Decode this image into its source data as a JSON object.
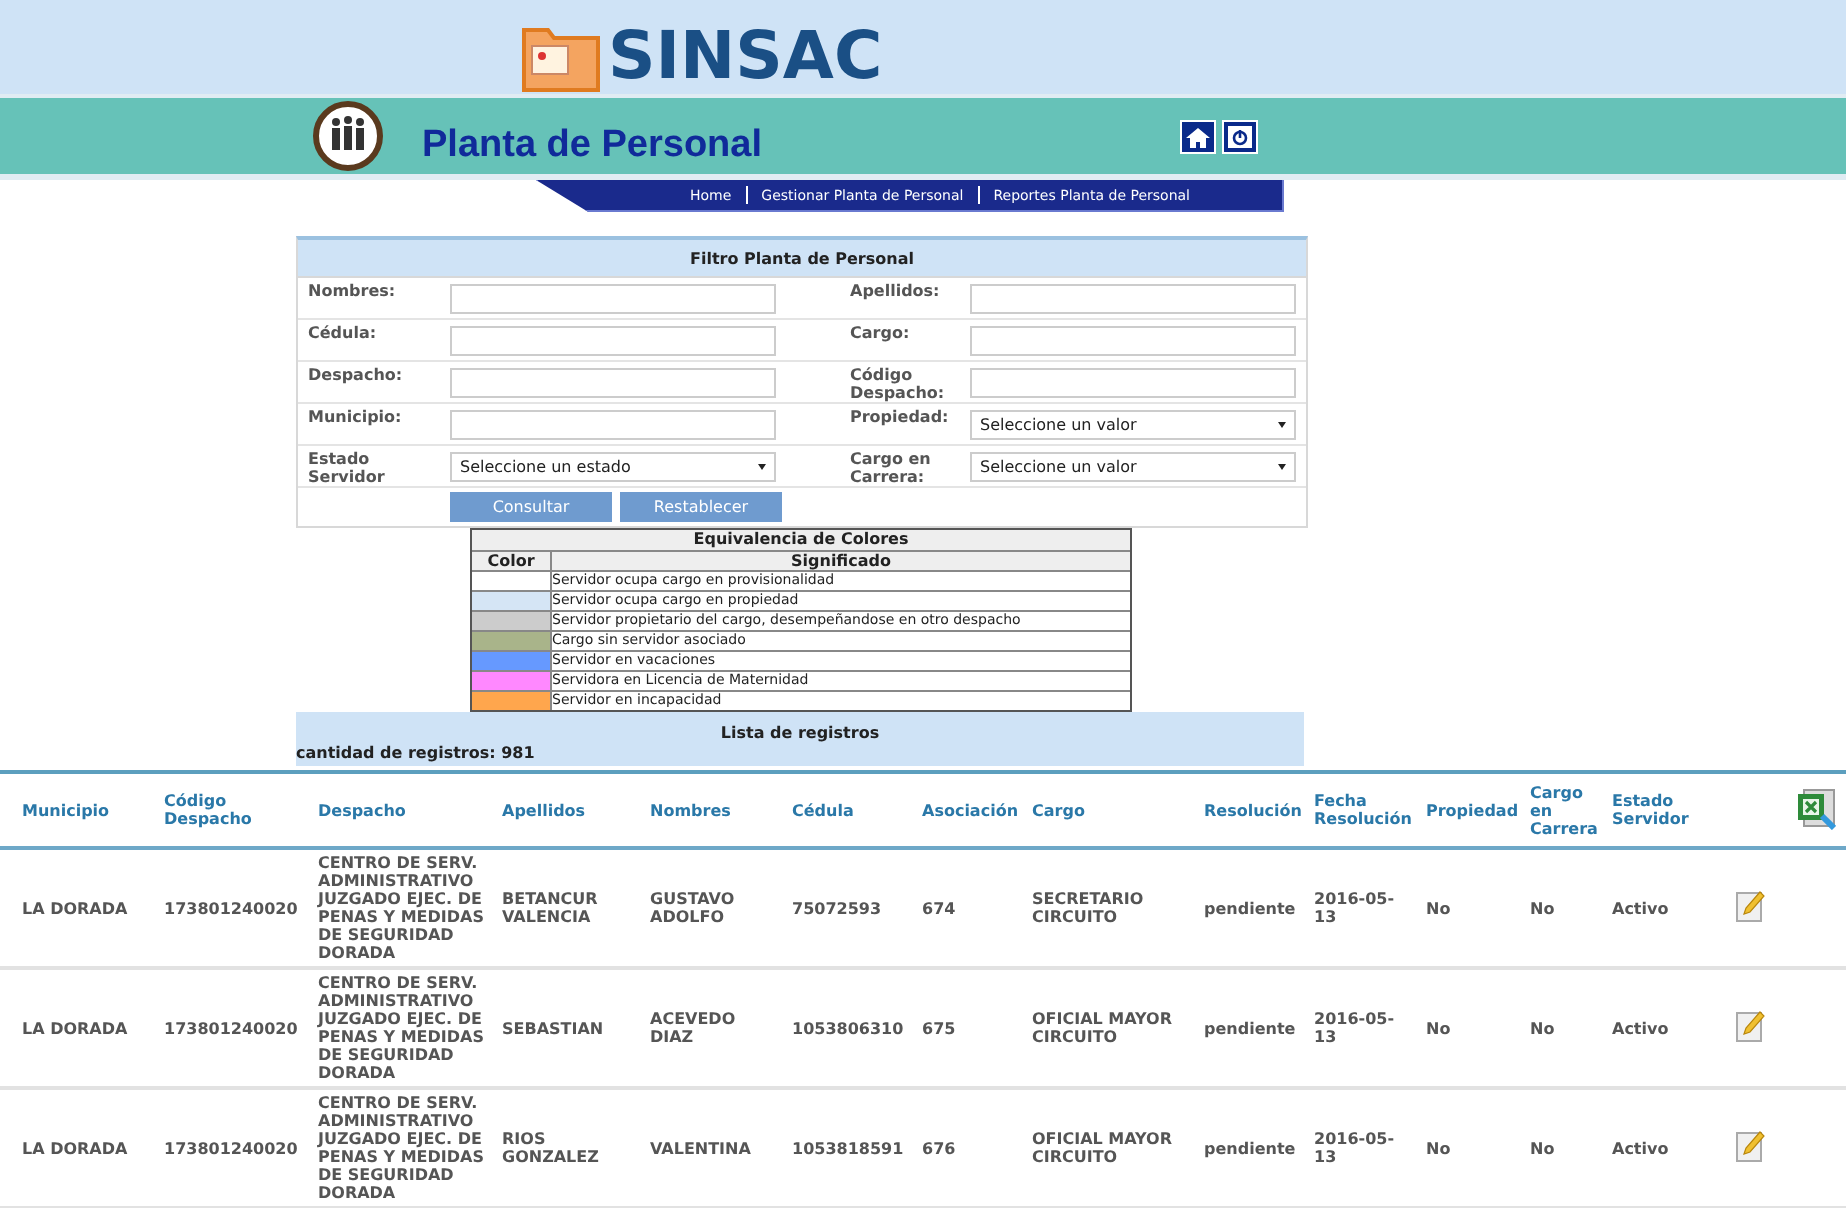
{
  "header": {
    "logo": "SINSAC"
  },
  "banner": {
    "title": "Planta de Personal"
  },
  "nav": [
    "Home",
    "Gestionar Planta de Personal",
    "Reportes Planta de Personal"
  ],
  "filter": {
    "title": "Filtro Planta de Personal",
    "fields": [
      {
        "label": "Nombres:",
        "kind": "text"
      },
      {
        "label": "Apellidos:",
        "kind": "text"
      },
      {
        "label": "Cédula:",
        "kind": "text"
      },
      {
        "label": "Cargo:",
        "kind": "text"
      },
      {
        "label": "Despacho:",
        "kind": "text"
      },
      {
        "label": "Código Despacho:",
        "kind": "text"
      },
      {
        "label": "Municipio:",
        "kind": "text"
      },
      {
        "label": "Propiedad:",
        "kind": "select",
        "value": "Seleccione un valor"
      },
      {
        "label": "Estado Servidor",
        "kind": "select",
        "value": "Seleccione un estado"
      },
      {
        "label": "Cargo en Carrera:",
        "kind": "select",
        "value": "Seleccione un valor"
      }
    ],
    "buttons": [
      "Consultar",
      "Restablecer"
    ]
  },
  "legend": {
    "title": "Equivalencia de Colores",
    "columns": [
      "Color",
      "Significado"
    ],
    "items": [
      {
        "color": "#ffffff",
        "label": "Servidor ocupa cargo en provisionalidad"
      },
      {
        "color": "#d5e5f5",
        "label": "Servidor ocupa cargo en propiedad"
      },
      {
        "color": "#cccccc",
        "label": "Servidor propietario del cargo, desempeñandose en otro despacho"
      },
      {
        "color": "#a9b48a",
        "label": "Cargo sin servidor asociado"
      },
      {
        "color": "#6699ff",
        "label": "Servidor en vacaciones"
      },
      {
        "color": "#ff88ff",
        "label": "Servidora en Licencia de Maternidad"
      },
      {
        "color": "#ffa64d",
        "label": "Servidor en incapacidad"
      }
    ]
  },
  "list": {
    "title": "Lista de registros",
    "count": "cantidad de registros: 981"
  },
  "table": {
    "columns": [
      "Municipio",
      "Código Despacho",
      "Despacho",
      "Apellidos",
      "Nombres",
      "Cédula",
      "Asociación",
      "Cargo",
      "Resolución",
      "Fecha Resolución",
      "Propiedad",
      "Cargo en Carrera",
      "Estado Servidor"
    ],
    "rows": [
      [
        "LA DORADA",
        "173801240020",
        "CENTRO DE SERV. ADMINISTRATIVO JUZGADO EJEC. DE PENAS Y MEDIDAS DE SEGURIDAD DORADA",
        "BETANCUR VALENCIA",
        "GUSTAVO ADOLFO",
        "75072593",
        "674",
        "SECRETARIO CIRCUITO",
        "pendiente",
        "2016-05-13",
        "No",
        "No",
        "Activo"
      ],
      [
        "LA DORADA",
        "173801240020",
        "CENTRO DE SERV. ADMINISTRATIVO JUZGADO EJEC. DE PENAS Y MEDIDAS DE SEGURIDAD DORADA",
        "SEBASTIAN",
        "ACEVEDO DIAZ",
        "1053806310",
        "675",
        "OFICIAL MAYOR CIRCUITO",
        "pendiente",
        "2016-05-13",
        "No",
        "No",
        "Activo"
      ],
      [
        "LA DORADA",
        "173801240020",
        "CENTRO DE SERV. ADMINISTRATIVO JUZGADO EJEC. DE PENAS Y MEDIDAS DE SEGURIDAD DORADA",
        "RIOS GONZALEZ",
        "VALENTINA",
        "1053818591",
        "676",
        "OFICIAL MAYOR CIRCUITO",
        "pendiente",
        "2016-05-13",
        "No",
        "No",
        "Activo"
      ]
    ]
  }
}
